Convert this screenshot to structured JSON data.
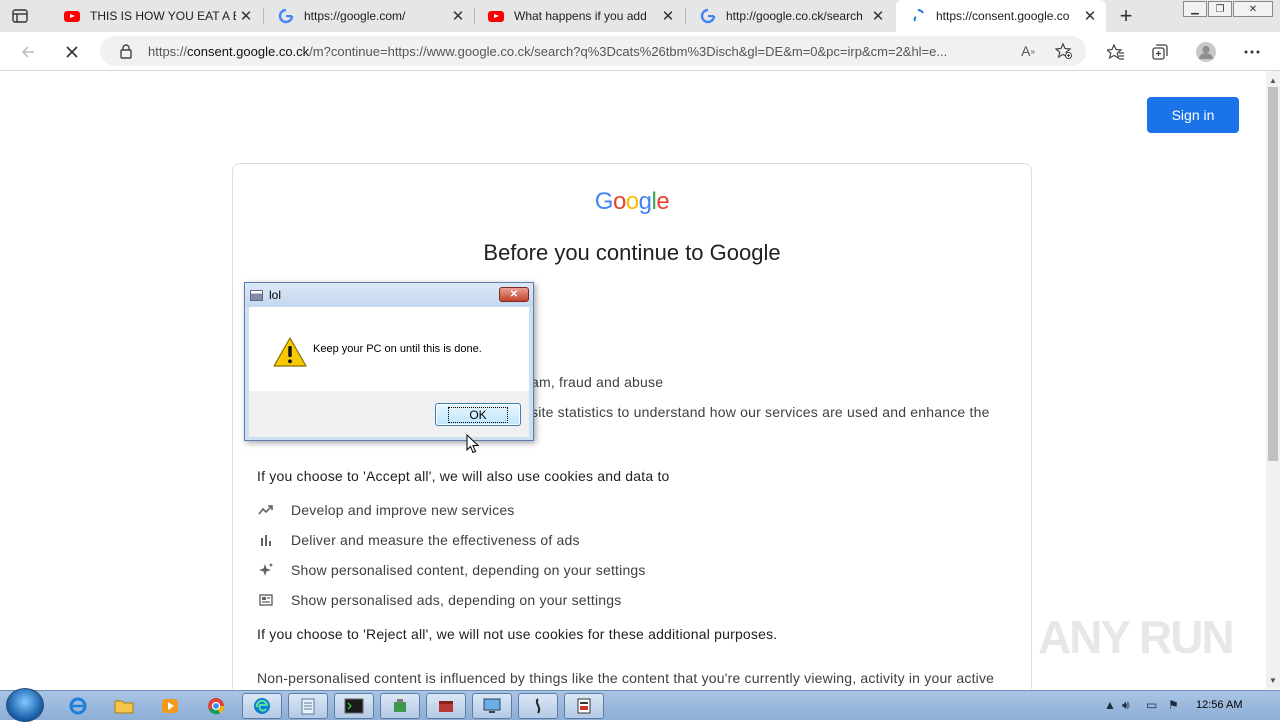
{
  "browser": {
    "tabs": [
      {
        "title": "THIS IS HOW YOU EAT A B",
        "icon": "youtube-icon",
        "active": false
      },
      {
        "title": "https://google.com/",
        "icon": "google-icon",
        "active": false
      },
      {
        "title": "What happens if you add",
        "icon": "youtube-icon",
        "active": false
      },
      {
        "title": "http://google.co.ck/search",
        "icon": "google-icon",
        "active": false
      },
      {
        "title": "https://consent.google.co",
        "icon": "loading-icon",
        "active": true
      }
    ],
    "url_prefix": "https://",
    "url_domain": "consent.google.co.ck",
    "url_rest": "/m?continue=https://www.google.co.ck/search?q%3Dcats%26tbm%3Disch&gl=DE&m=0&pc=irp&cm=2&hl=e..."
  },
  "page": {
    "sign_in_label": "Sign in",
    "logo_text": "Google",
    "heading": "Before you continue to Google",
    "partial_line_1": "am, fraud and abuse",
    "partial_line_2": "site statistics to understand how our services are used and enhance the",
    "accept_intro": "If you choose to 'Accept all', we will also use cookies and data to",
    "accept_items": [
      {
        "icon": "trend-icon",
        "text": "Develop and improve new services"
      },
      {
        "icon": "bar-chart-icon",
        "text": "Deliver and measure the effectiveness of ads"
      },
      {
        "icon": "sparkle-icon",
        "text": "Show personalised content, depending on your settings"
      },
      {
        "icon": "newspaper-icon",
        "text": "Show personalised ads, depending on your settings"
      }
    ],
    "reject_text": "If you choose to 'Reject all', we will not use cookies for these additional purposes.",
    "nonpersonal_text": "Non-personalised content is influenced by things like the content that you're currently viewing, activity in your active"
  },
  "dialog": {
    "title": "lol",
    "message": "Keep your PC on until this is done.",
    "ok_label": "OK",
    "icon": "warning-icon"
  },
  "watermark": "ANY RUN",
  "taskbar": {
    "clock": "12:56 AM"
  },
  "colors": {
    "accent": "#1a73e8",
    "google_blue": "#4285f4",
    "google_red": "#ea4335",
    "google_yellow": "#fbbc05",
    "google_green": "#34a853"
  }
}
